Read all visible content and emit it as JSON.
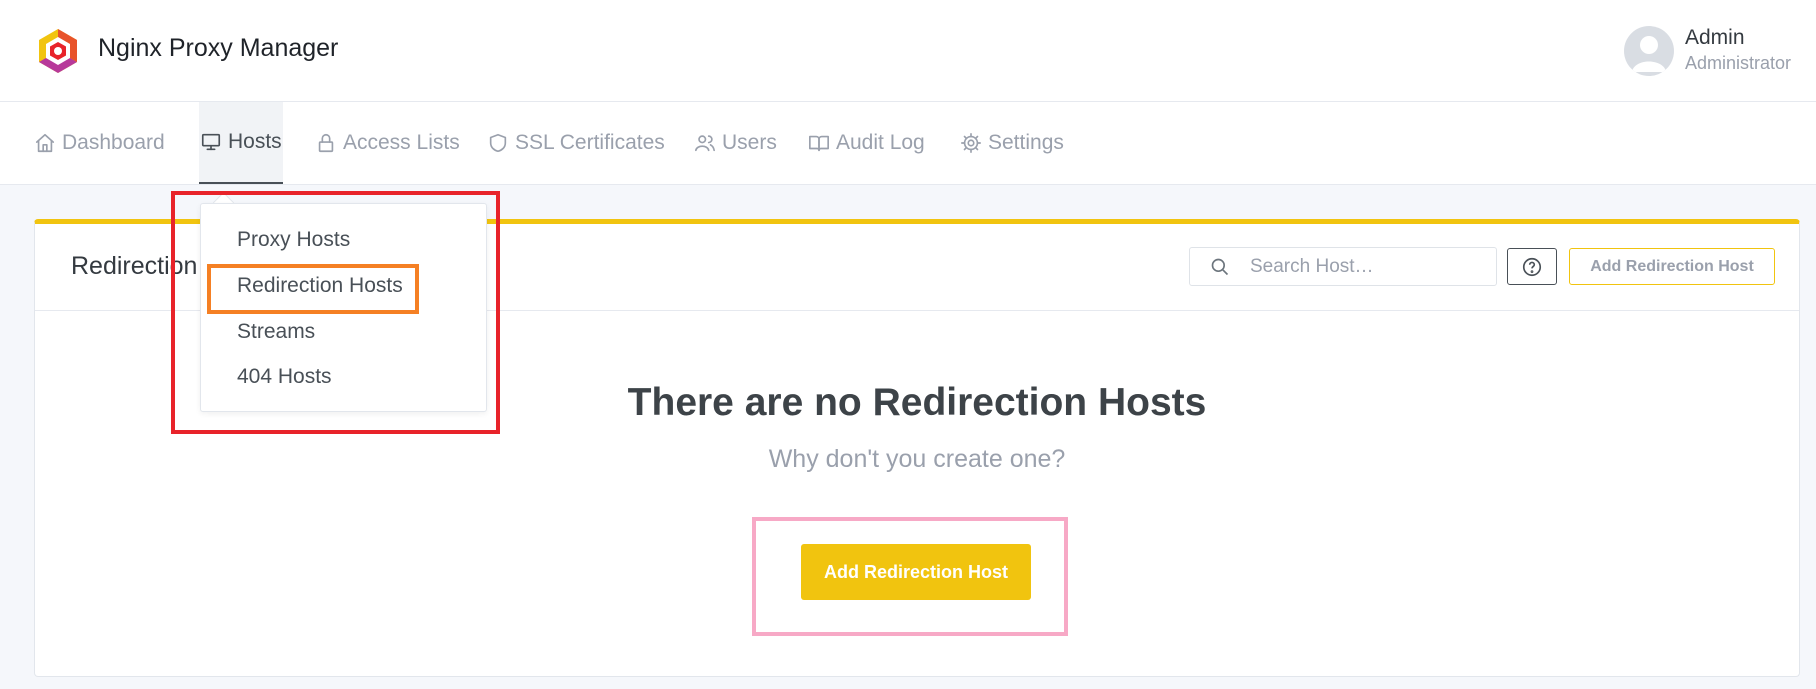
{
  "app": {
    "title": "Nginx Proxy Manager",
    "brand_colors": [
      "#f1c40f",
      "#e8232a",
      "#b7399a"
    ]
  },
  "user": {
    "name": "Admin",
    "role": "Administrator"
  },
  "nav": {
    "items": [
      {
        "label": "Dashboard",
        "icon": "home-icon"
      },
      {
        "label": "Hosts",
        "icon": "monitor-icon",
        "active": true
      },
      {
        "label": "Access Lists",
        "icon": "lock-icon"
      },
      {
        "label": "SSL Certificates",
        "icon": "shield-icon"
      },
      {
        "label": "Users",
        "icon": "users-icon"
      },
      {
        "label": "Audit Log",
        "icon": "book-icon"
      },
      {
        "label": "Settings",
        "icon": "gear-icon"
      }
    ]
  },
  "dropdown": {
    "items": [
      "Proxy Hosts",
      "Redirection Hosts",
      "Streams",
      "404 Hosts"
    ],
    "highlighted": "Redirection Hosts"
  },
  "card": {
    "title": "Redirection Hosts",
    "search_placeholder": "Search Host…",
    "add_button": "Add Redirection Host",
    "accent_color": "#f1c40f"
  },
  "empty_state": {
    "title": "There are no Redirection Hosts",
    "subtitle": "Why don't you create one?",
    "button": "Add Redirection Host"
  },
  "annotations": {
    "red_box_color": "#e8232a",
    "orange_box_color": "#f58024",
    "pink_box_color": "#f7a9c6"
  }
}
